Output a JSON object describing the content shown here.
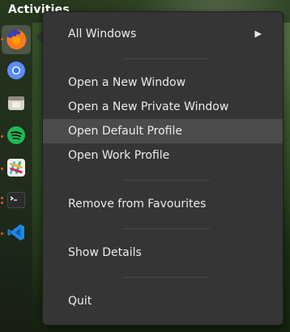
{
  "topbar": {
    "activities_label": "Activities"
  },
  "dock": {
    "items": [
      {
        "name": "firefox-icon",
        "active": true,
        "running": true
      },
      {
        "name": "chromium-icon",
        "active": false,
        "running": false
      },
      {
        "name": "files-icon",
        "active": false,
        "running": false
      },
      {
        "name": "spotify-icon",
        "active": false,
        "running": true
      },
      {
        "name": "slack-icon",
        "active": false,
        "running": true
      },
      {
        "name": "terminal-icon",
        "active": false,
        "running": true
      },
      {
        "name": "vscode-icon",
        "active": false,
        "running": true
      }
    ],
    "colors": {
      "running_dot": "#e95420"
    }
  },
  "menu": {
    "all_windows": "All Windows",
    "new_window": "Open a New Window",
    "new_private_window": "Open a New Private Window",
    "default_profile": "Open Default Profile",
    "work_profile": "Open Work Profile",
    "remove_favourites": "Remove from Favourites",
    "show_details": "Show Details",
    "quit": "Quit"
  }
}
